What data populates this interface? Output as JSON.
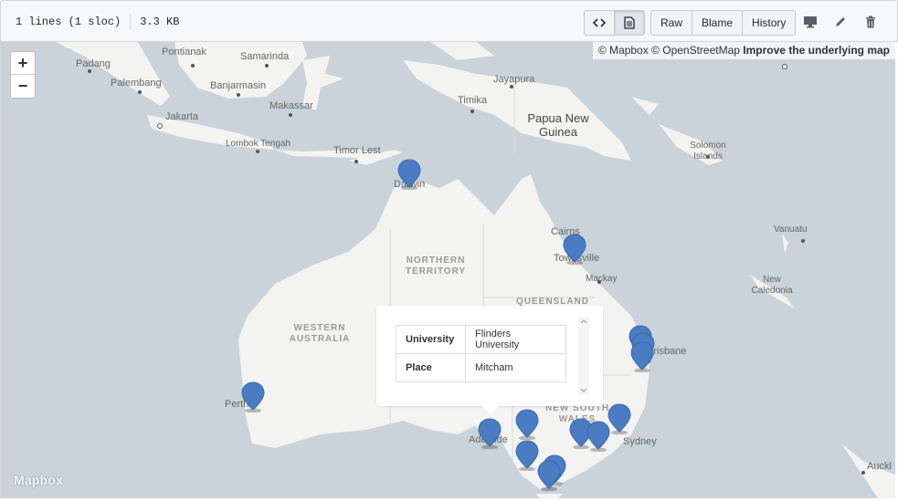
{
  "file_header": {
    "lines": "1 lines (1 sloc)",
    "size": "3.3 KB",
    "buttons": {
      "code_icon": "code-icon",
      "rendered_icon": "file-icon",
      "raw": "Raw",
      "blame": "Blame",
      "history": "History"
    },
    "icons": [
      "desktop-icon",
      "pencil-icon",
      "trash-icon"
    ]
  },
  "map": {
    "attribution_prefix": "© Mapbox © OpenStreetMap",
    "attribution_link": "Improve the underlying map",
    "zoom_in": "+",
    "zoom_out": "−",
    "logo": "Mapbox",
    "colors": {
      "water": "#c9d3d9",
      "land": "#f3f3f2",
      "marker": "#4a7cc4"
    },
    "labels": {
      "padang": "Padang",
      "pontianak": "Pontianak",
      "samarinda": "Samarinda",
      "palembang": "Palembang",
      "banjarmasin": "Banjarmasin",
      "makassar": "Makassar",
      "jakarta": "Jakarta",
      "lombok": "Lombok Tengah",
      "timor": "Timor Lest",
      "jayapura": "Jayapura",
      "timika": "Timika",
      "png": "Papua New Guinea",
      "solomon": "Solomon Islands",
      "darwin": "Darwin",
      "cairns": "Cairns",
      "townsville": "Townsville",
      "mackay": "Mackay",
      "vanuatu": "Vanuatu",
      "nt": "NORTHERN TERRITORY",
      "qld": "QUEENSLAND",
      "wa": "WESTERN AUSTRALIA",
      "nsw": "NEW SOUTH WALES",
      "newcal": "New Caledonia",
      "brisbane": "Brisbane",
      "perth": "Perth",
      "adelaide": "Adelaide",
      "sydney": "Sydney",
      "auckland": "Auckl"
    }
  },
  "popup": {
    "rows": [
      {
        "key": "University",
        "value": "Flinders University"
      },
      {
        "key": "Place",
        "value": "Mitcham"
      }
    ]
  }
}
